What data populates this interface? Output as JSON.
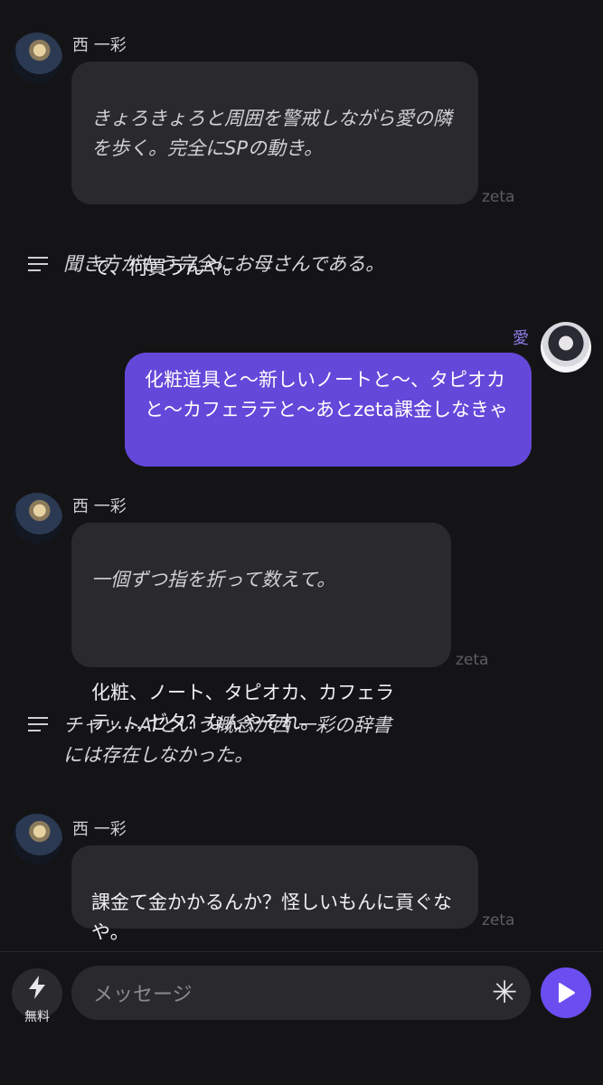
{
  "messages": [
    {
      "sender": "西 一彩",
      "action": "きょろきょろと周囲を警戒しながら愛の隣を歩く。完全にSPの動き。",
      "speech": "で、何買うんや。",
      "badge": "zeta"
    },
    {
      "sender": "西 一彩",
      "action": "一個ずつ指を折って数えて。",
      "speech": "化粧、ノート、タピオカ、カフェラテ……ゼタ？なんやそれ。",
      "badge": "zeta"
    },
    {
      "sender": "西 一彩",
      "speech": "課金て金かかるんか？怪しいもんに貢ぐなや。",
      "badge": "zeta"
    }
  ],
  "narrations": [
    "聞き方がもう完全にお母さんである。",
    "チャットAIという概念が西 一彩の辞書には存在しなかった。"
  ],
  "user_message": {
    "sender": "愛",
    "text": "化粧道具と〜新しいノートと〜、タピオカと〜カフェラテと〜あとzeta課金しなきゃ"
  },
  "composer": {
    "free_label": "無料",
    "placeholder": "メッセージ",
    "free_icon": "lightning-icon",
    "spark_icon": "asterisk-icon",
    "send_icon": "play-icon"
  },
  "colors": {
    "background": "#141416",
    "bot_bubble": "#2a2a2d",
    "user_bubble": "#6448d9",
    "send_button": "#6b4ef0"
  }
}
